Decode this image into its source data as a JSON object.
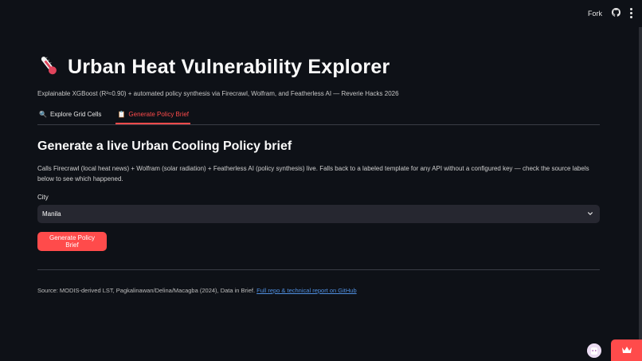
{
  "header": {
    "fork_label": "Fork",
    "icons": [
      "github-icon",
      "kebab-menu-icon"
    ]
  },
  "page": {
    "title": "Urban Heat Vulnerability Explorer",
    "subtitle": "Explainable XGBoost (R²≈0.90) + automated policy synthesis via Firecrawl, Wolfram, and Featherless AI — Reverie Hacks 2026",
    "title_icon": "thermometer-icon"
  },
  "tabs": [
    {
      "label": "Explore Grid Cells",
      "icon": "🔍",
      "active": false
    },
    {
      "label": "Generate Policy Brief",
      "icon": "📋",
      "active": true
    }
  ],
  "brief": {
    "heading": "Generate a live Urban Cooling Policy brief",
    "description": "Calls Firecrawl (local heat news) + Wolfram (solar radiation) + Featherless AI (policy synthesis) live. Falls back to a labeled template for any API without a configured key — check the source labels below to see which happened.",
    "city_label": "City",
    "city_value": "Manila",
    "button_label": "Generate Policy Brief"
  },
  "footer": {
    "source_text": "Source: MODIS-derived LST, Pagkalinawan/Delina/Macagba (2024), Data in Brief.",
    "link_text": "Full repo & technical report on GitHub"
  },
  "colors": {
    "background": "#0e1117",
    "accent": "#ff4b4b",
    "select_bg": "#262730",
    "link": "#4f8fe0"
  }
}
